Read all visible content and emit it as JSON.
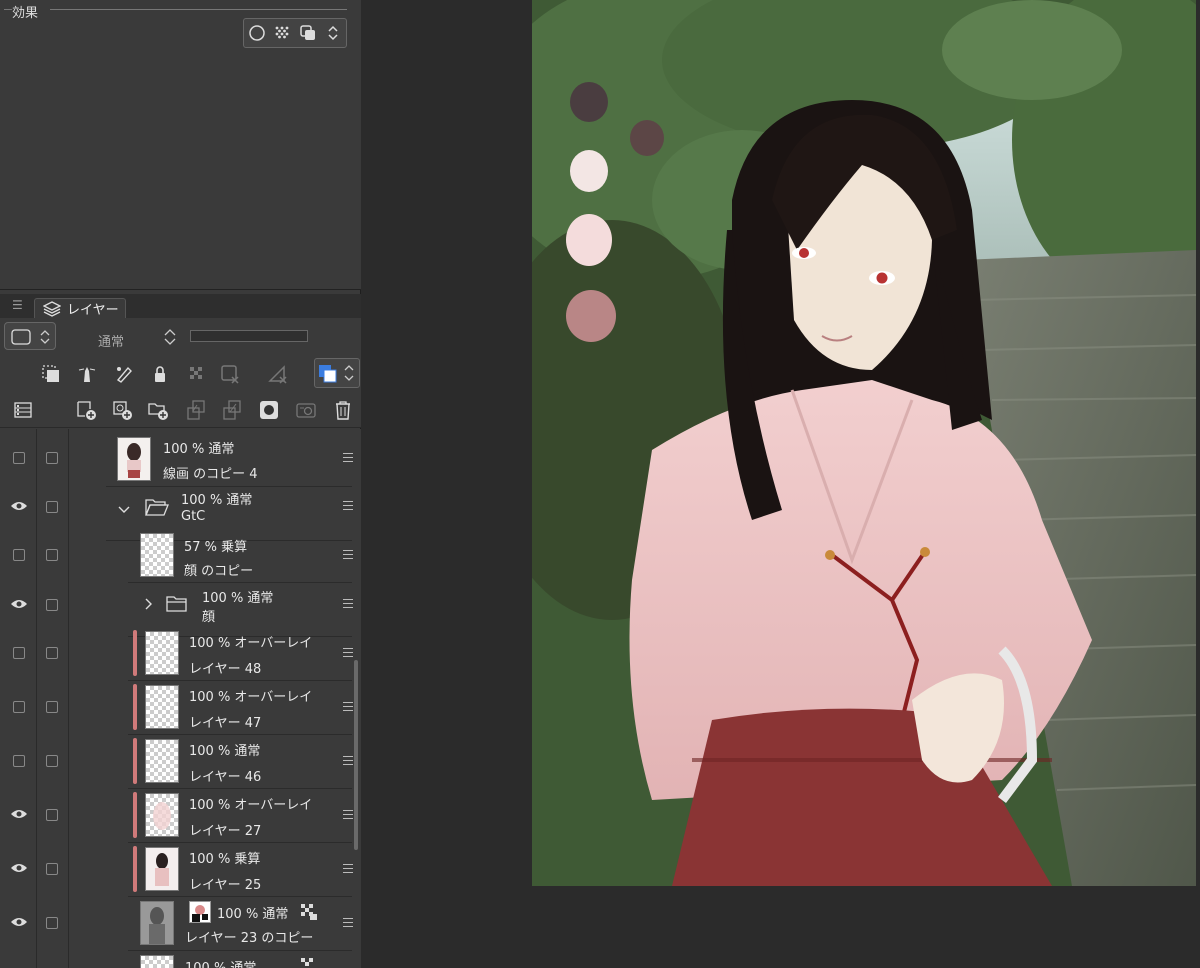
{
  "effect": {
    "title": "効果",
    "buttons": [
      "circle-icon",
      "halftone-icon",
      "duplicate-icon",
      "updown-icon"
    ]
  },
  "layer_panel": {
    "tab_label": "レイヤー",
    "blend_mode": "通常"
  },
  "layers": [
    {
      "opacity_mode": "100 % 通常",
      "name": "線画 のコピー 4",
      "visible": false,
      "type": "raster"
    },
    {
      "opacity_mode": "100 % 通常",
      "name": "GtC",
      "visible": true,
      "type": "folder-open"
    },
    {
      "opacity_mode": "57 % 乗算",
      "name": "顔 のコピー",
      "visible": false,
      "type": "raster"
    },
    {
      "opacity_mode": "100 % 通常",
      "name": "顔",
      "visible": true,
      "type": "folder-closed"
    },
    {
      "opacity_mode": "100 % オーバーレイ",
      "name": "レイヤー 48",
      "visible": false,
      "type": "clipped"
    },
    {
      "opacity_mode": "100 % オーバーレイ",
      "name": "レイヤー 47",
      "visible": false,
      "type": "clipped"
    },
    {
      "opacity_mode": "100 % 通常",
      "name": "レイヤー 46",
      "visible": false,
      "type": "clipped"
    },
    {
      "opacity_mode": "100 % オーバーレイ",
      "name": "レイヤー 27",
      "visible": true,
      "type": "clipped"
    },
    {
      "opacity_mode": "100 % 乗算",
      "name": "レイヤー 25",
      "visible": true,
      "type": "clipped"
    },
    {
      "opacity_mode": "100 % 通常",
      "name": "レイヤー 23 のコピー",
      "visible": true,
      "type": "masked"
    },
    {
      "opacity_mode": "100 % 通常",
      "name": "",
      "visible": false,
      "type": "raster"
    }
  ],
  "palette": {
    "swatches": [
      "#4a3d40",
      "#5c4646",
      "#f3e6e4",
      "#f4dcdc",
      "#b98686"
    ]
  }
}
